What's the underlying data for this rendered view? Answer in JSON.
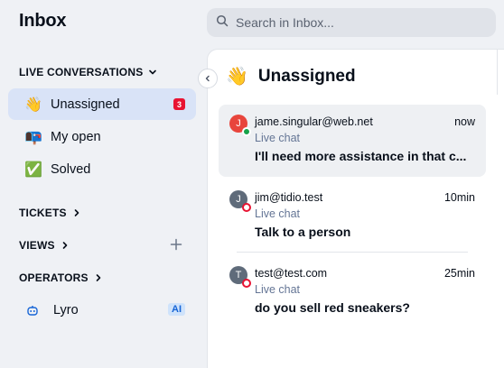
{
  "sidebar": {
    "title": "Inbox",
    "live_conversations_label": "LIVE CONVERSATIONS",
    "items": [
      {
        "emoji": "👋",
        "label": "Unassigned",
        "badge": "3"
      },
      {
        "emoji": "📭",
        "label": "My open"
      },
      {
        "emoji": "✅",
        "label": "Solved"
      }
    ],
    "tickets_label": "TICKETS",
    "views_label": "VIEWS",
    "operators_label": "OPERATORS",
    "lyro": {
      "label": "Lyro",
      "badge": "AI"
    }
  },
  "search": {
    "placeholder": "Search in Inbox..."
  },
  "panel": {
    "emoji": "👋",
    "title": "Unassigned",
    "conversations": [
      {
        "email": "jame.singular@web.net",
        "time": "now",
        "channel": "Live chat",
        "message": "I'll need more assistance in that c...",
        "avatar": "J",
        "avatar_color": "#e8453c",
        "status": "online"
      },
      {
        "email": "jim@tidio.test",
        "time": "10min",
        "channel": "Live chat",
        "message": "Talk to a person",
        "avatar": "J",
        "avatar_color": "#5f6b7a",
        "status": "offline"
      },
      {
        "email": "test@test.com",
        "time": "25min",
        "channel": "Live chat",
        "message": "do you sell red sneakers?",
        "avatar": "T",
        "avatar_color": "#5f6b7a",
        "status": "offline"
      }
    ]
  },
  "colors": {
    "accent": "#1765d6",
    "active_bg": "#d9e3f7",
    "badge_red": "#e81332"
  }
}
